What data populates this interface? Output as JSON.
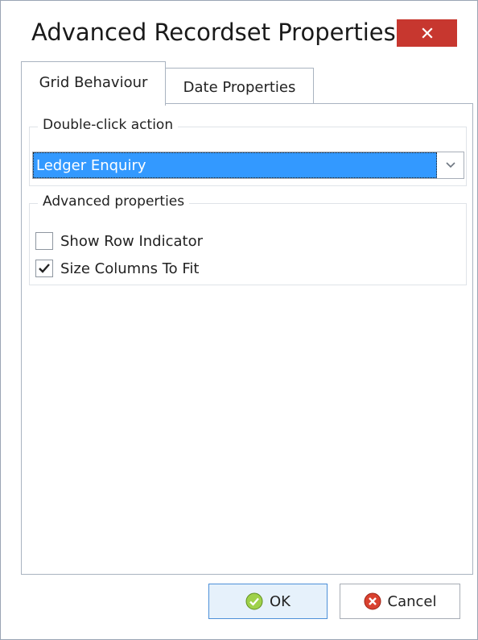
{
  "window": {
    "title": "Advanced Recordset Properties",
    "close_icon": "close-icon",
    "close_color": "#c7372f"
  },
  "tabs": [
    {
      "label": "Grid Behaviour",
      "selected": true
    },
    {
      "label": "Date Properties",
      "selected": false
    }
  ],
  "double_click_group": {
    "label": "Double-click action",
    "selected_value": "Ledger Enquiry",
    "selection_color": "#3399ff"
  },
  "advanced_group": {
    "label": "Advanced properties",
    "options": [
      {
        "label": "Show Row Indicator",
        "checked": false
      },
      {
        "label": "Size Columns To Fit",
        "checked": true
      }
    ]
  },
  "buttons": {
    "ok_label": "OK",
    "ok_icon": "check-circle-icon",
    "cancel_label": "Cancel",
    "cancel_icon": "cancel-circle-icon"
  }
}
